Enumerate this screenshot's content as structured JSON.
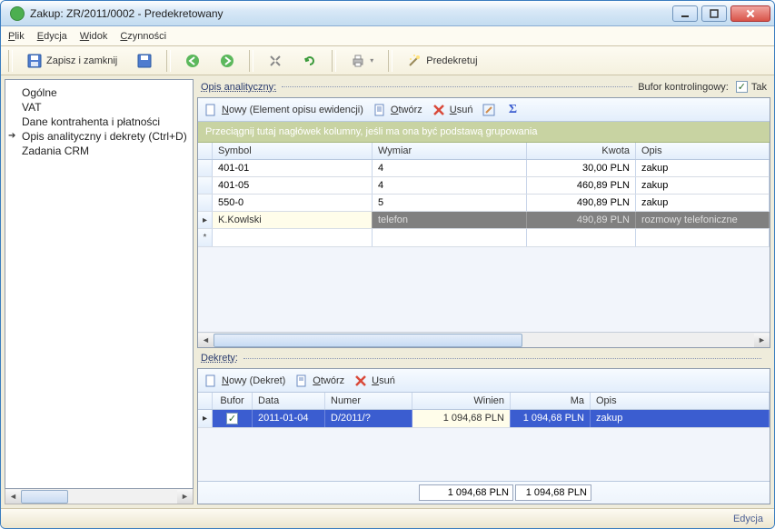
{
  "titlebar": {
    "title": "Zakup: ZR/2011/0002 - Predekretowany"
  },
  "menu": {
    "plik": "Plik",
    "edycja": "Edycja",
    "widok": "Widok",
    "czynnosci": "Czynności"
  },
  "toolbar": {
    "save_close": "Zapisz i zamknij",
    "predekretuj": "Predekretuj"
  },
  "sidebar": {
    "items": [
      {
        "label": "Ogólne"
      },
      {
        "label": "VAT"
      },
      {
        "label": "Dane kontrahenta i płatności"
      },
      {
        "label": "Opis analityczny i dekrety (Ctrl+D)"
      },
      {
        "label": "Zadania CRM"
      }
    ],
    "selected_index": 3
  },
  "opis_section": {
    "header": "Opis analityczny:",
    "bufor_label": "Bufor kontrolingowy:",
    "bufor_checked": true,
    "bufor_text": "Tak",
    "toolbar": {
      "nowy": "Nowy (Element opisu ewidencji)",
      "otworz": "Otwórz",
      "usun": "Usuń"
    },
    "group_hint": "Przeciągnij tutaj nagłówek kolumny, jeśli ma ona być podstawą grupowania",
    "columns": {
      "symbol": "Symbol",
      "wymiar": "Wymiar",
      "kwota": "Kwota",
      "opis": "Opis"
    },
    "rows": [
      {
        "symbol": "401-01",
        "wymiar": "4",
        "kwota": "30,00 PLN",
        "opis": "zakup"
      },
      {
        "symbol": "401-05",
        "wymiar": "4",
        "kwota": "460,89 PLN",
        "opis": "zakup"
      },
      {
        "symbol": "550-0",
        "wymiar": "5",
        "kwota": "490,89 PLN",
        "opis": "zakup"
      },
      {
        "symbol": "K.Kowlski",
        "wymiar": "telefon",
        "kwota": "490,89 PLN",
        "opis": "rozmowy telefoniczne"
      }
    ]
  },
  "dekrety_section": {
    "header": "Dekrety:",
    "toolbar": {
      "nowy": "Nowy (Dekret)",
      "otworz": "Otwórz",
      "usun": "Usuń"
    },
    "columns": {
      "bufor": "Bufor",
      "data": "Data",
      "numer": "Numer",
      "winien": "Winien",
      "ma": "Ma",
      "opis": "Opis"
    },
    "rows": [
      {
        "bufor_checked": true,
        "data": "2011-01-04",
        "numer": "D/2011/?",
        "winien": "1 094,68 PLN",
        "ma": "1 094,68 PLN",
        "opis": "zakup"
      }
    ],
    "totals": {
      "winien": "1 094,68 PLN",
      "ma": "1 094,68 PLN"
    }
  },
  "statusbar": {
    "mode": "Edycja"
  }
}
